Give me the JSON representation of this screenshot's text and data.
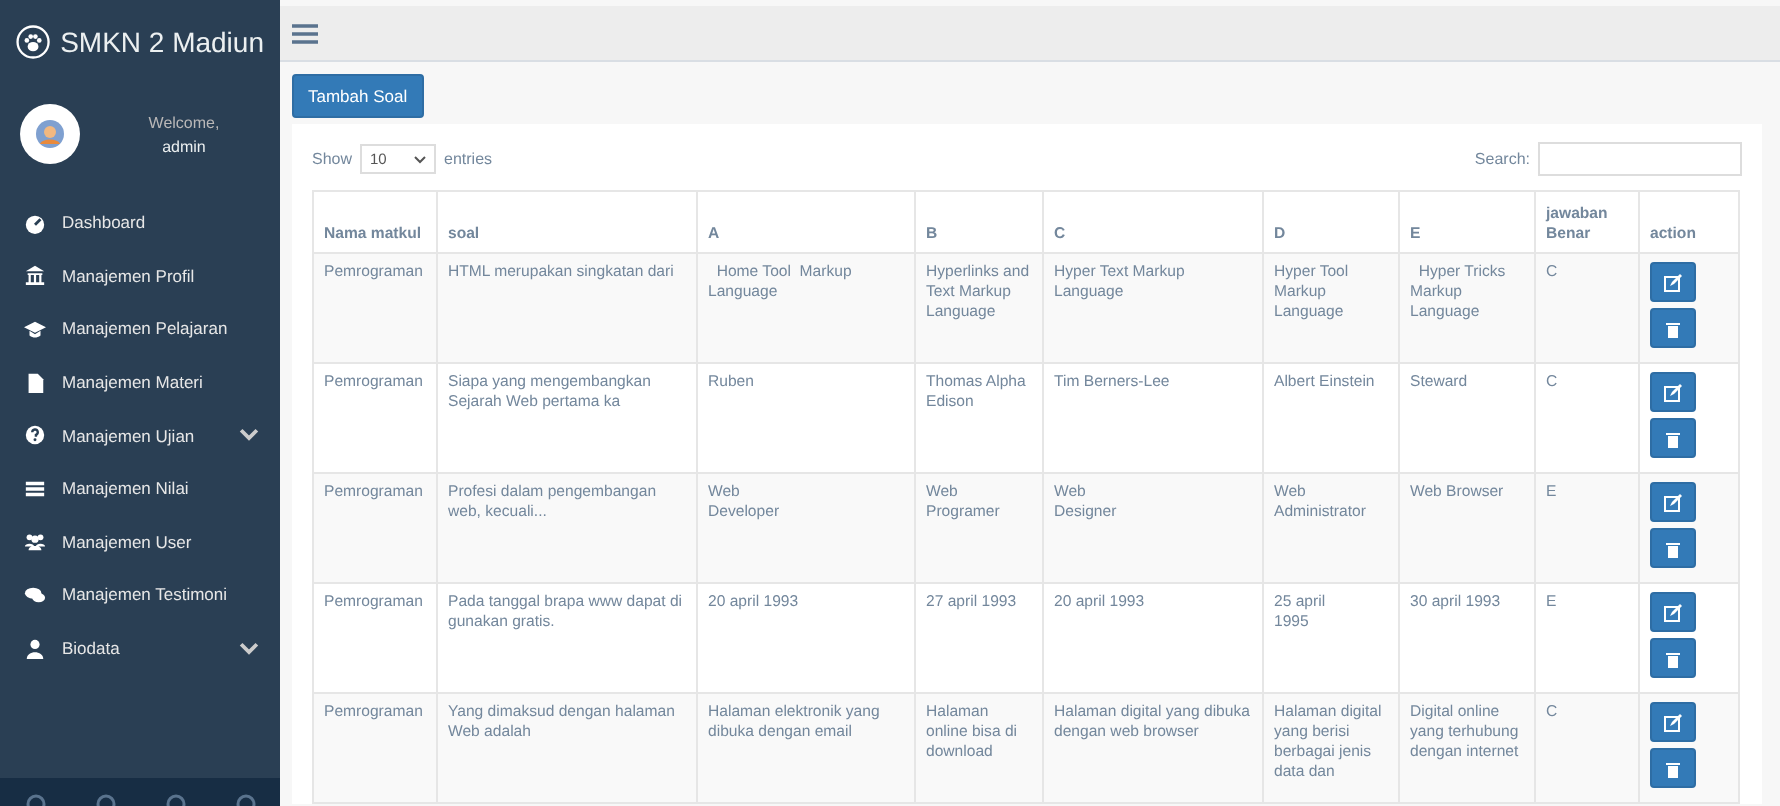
{
  "brand": {
    "title": "SMKN 2 Madiun"
  },
  "profile": {
    "welcome": "Welcome,",
    "name": "admin"
  },
  "sidebar": {
    "items": [
      {
        "label": "Dashboard",
        "has_submenu": false
      },
      {
        "label": "Manajemen Profil",
        "has_submenu": false
      },
      {
        "label": "Manajemen Pelajaran",
        "has_submenu": false
      },
      {
        "label": "Manajemen Materi",
        "has_submenu": false
      },
      {
        "label": "Manajemen Ujian",
        "has_submenu": true
      },
      {
        "label": "Manajemen Nilai",
        "has_submenu": false
      },
      {
        "label": "Manajemen User",
        "has_submenu": false
      },
      {
        "label": "Manajemen Testimoni",
        "has_submenu": false
      },
      {
        "label": "Biodata",
        "has_submenu": true
      }
    ]
  },
  "add_button": "Tambah Soal",
  "table_controls": {
    "show_label": "Show",
    "entries_value": "10",
    "entries_label": "entries",
    "search_label": "Search:"
  },
  "table": {
    "columns": [
      "Nama matkul",
      "soal",
      "A",
      "B",
      "C",
      "D",
      "E",
      "jawaban Benar",
      "action"
    ],
    "rows": [
      {
        "cells": [
          "Pemrograman",
          "HTML merupakan singkatan dari",
          "  Home Tool  Markup Language",
          "Hyperlinks and Text Markup Language",
          "Hyper Text Markup Language",
          "Hyper Tool Markup Language",
          "  Hyper Tricks Markup Language",
          "C"
        ]
      },
      {
        "cells": [
          "Pemrograman",
          "Siapa yang mengembangkan Sejarah Web pertama ka",
          "Ruben",
          "Thomas Alpha Edison",
          "Tim Berners-Lee",
          "Albert Einstein",
          "Steward",
          "C"
        ]
      },
      {
        "cells": [
          "Pemrograman",
          "Profesi dalam pengembangan web, kecuali...",
          "Web\nDeveloper",
          "Web\nProgramer",
          "Web\nDesigner",
          "Web\nAdministrator",
          "Web Browser",
          "E"
        ]
      },
      {
        "cells": [
          "Pemrograman",
          "Pada tanggal brapa www dapat di gunakan gratis.",
          "20 april 1993",
          "27 april 1993",
          "20 april 1993",
          "25 april\n1995",
          "30 april 1993",
          "E"
        ]
      },
      {
        "cells": [
          "Pemrograman",
          "Yang dimaksud dengan halaman Web adalah",
          "Halaman elektronik yang dibuka dengan email",
          "Halaman online bisa di download",
          "Halaman digital yang dibuka dengan web browser",
          "Halaman digital yang berisi berbagai jenis data dan",
          "Digital online yang terhubung dengan internet",
          "C"
        ]
      }
    ]
  }
}
